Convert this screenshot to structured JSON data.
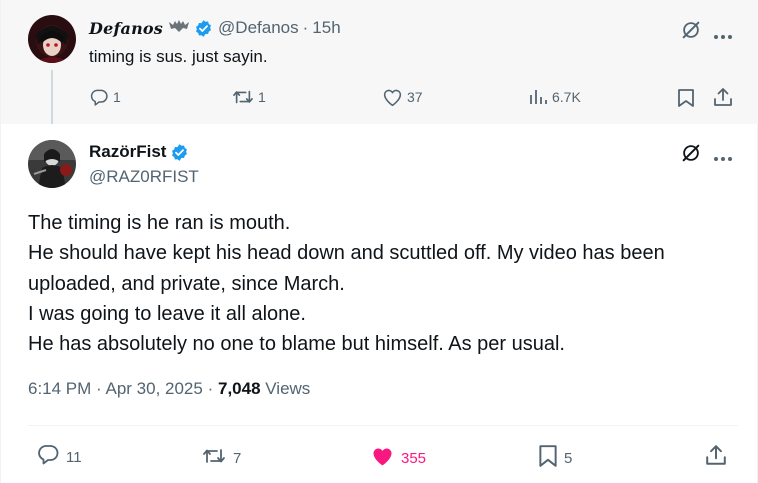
{
  "reply": {
    "display_name": "Defanos",
    "handle": "@Defanos",
    "separator": "·",
    "time": "15h",
    "text": "timing is sus. just sayin.",
    "replies": "1",
    "reposts": "1",
    "likes": "37",
    "views": "6.7K"
  },
  "main": {
    "display_name": "RazörFist",
    "handle": "@RAZ0RFIST",
    "lines": [
      "The timing is he ran is mouth.",
      "He should have kept his head down and scuttled off. My video has been",
      "uploaded, and private, since March.",
      "I was going to leave it all alone.",
      "He has absolutely no one to blame but himself. As per usual."
    ],
    "timestamp": "6:14 PM · Apr 30, 2025",
    "dot": "·",
    "views_count": "7,048",
    "views_label": "Views",
    "replies": "11",
    "reposts": "7",
    "likes": "355",
    "bookmarks": "5"
  },
  "colors": {
    "verified": "#1d9bf0",
    "liked": "#f91880",
    "muted": "#536471",
    "reply_bg": "#f7f7f7"
  },
  "icons": [
    "verified-badge-icon",
    "grok-icon",
    "more-icon",
    "reply-icon",
    "repost-icon",
    "like-icon",
    "views-icon",
    "bookmark-icon",
    "share-icon"
  ]
}
